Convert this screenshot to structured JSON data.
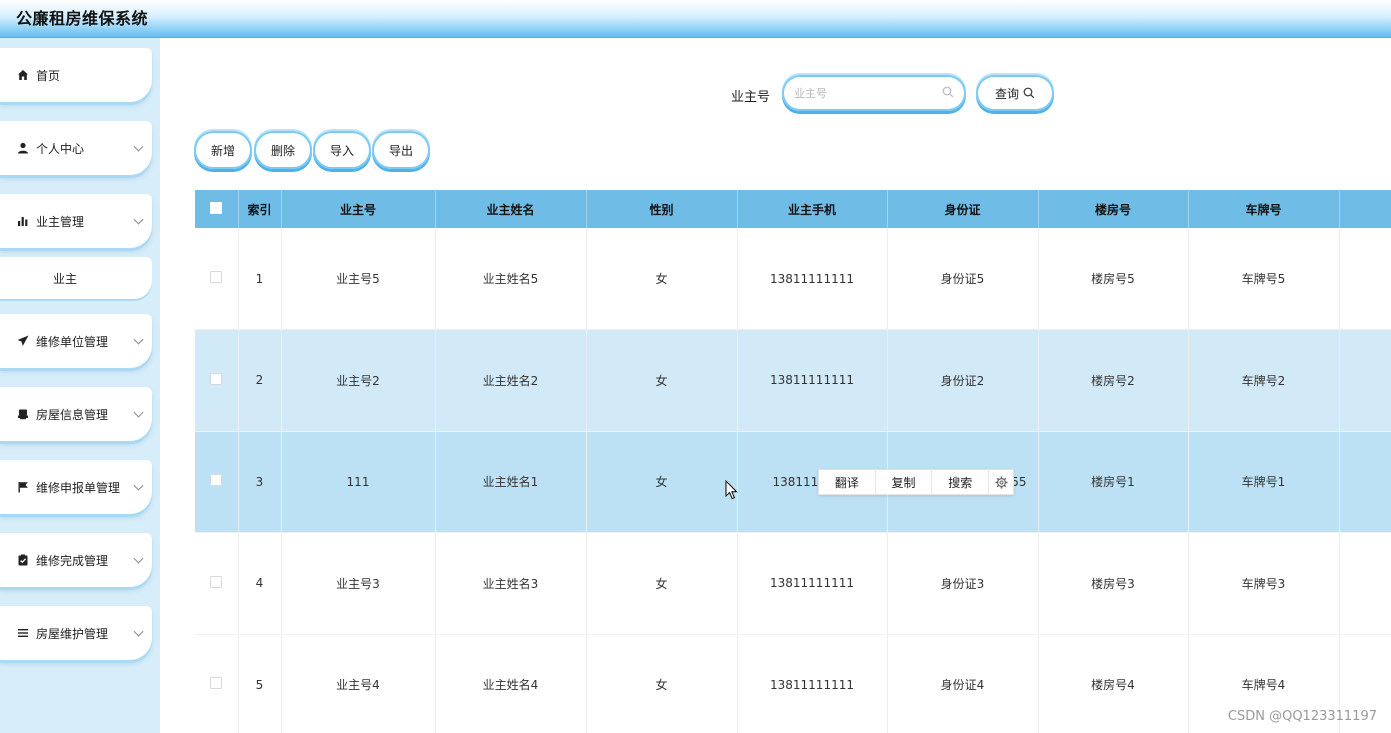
{
  "header": {
    "title": "公廉租房维保系统"
  },
  "sidebar": {
    "items": [
      {
        "label": "首页",
        "icon": "home-icon",
        "has_children": false
      },
      {
        "label": "个人中心",
        "icon": "user-icon",
        "has_children": true
      },
      {
        "label": "业主管理",
        "icon": "bar-chart-icon",
        "has_children": true,
        "expanded": true
      },
      {
        "label": "维修单位管理",
        "icon": "send-icon",
        "has_children": true
      },
      {
        "label": "房屋信息管理",
        "icon": "printer-icon",
        "has_children": true
      },
      {
        "label": "维修申报单管理",
        "icon": "flag-icon",
        "has_children": true
      },
      {
        "label": "维修完成管理",
        "icon": "clipboard-icon",
        "has_children": true
      },
      {
        "label": "房屋维护管理",
        "icon": "list-icon",
        "has_children": true
      }
    ],
    "submenu": {
      "label": "业主"
    }
  },
  "search": {
    "label": "业主号",
    "placeholder": "业主号",
    "value": "",
    "button_label": "查询"
  },
  "actions": {
    "add": "新增",
    "delete": "删除",
    "import": "导入",
    "export": "导出"
  },
  "table": {
    "columns": [
      "索引",
      "业主号",
      "业主姓名",
      "性别",
      "业主手机",
      "身份证",
      "楼房号",
      "车牌号"
    ],
    "rows": [
      {
        "index": "1",
        "owner_no": "业主号5",
        "name": "业主姓名5",
        "gender": "女",
        "phone": "13811111111",
        "id_card": "身份证5",
        "building": "楼房号5",
        "plate": "车牌号5"
      },
      {
        "index": "2",
        "owner_no": "业主号2",
        "name": "业主姓名2",
        "gender": "女",
        "phone": "13811111111",
        "id_card": "身份证2",
        "building": "楼房号2",
        "plate": "车牌号2"
      },
      {
        "index": "3",
        "owner_no": "111",
        "name": "业主姓名1",
        "gender": "女",
        "phone": "138111",
        "id_card": "55",
        "building": "楼房号1",
        "plate": "车牌号1"
      },
      {
        "index": "4",
        "owner_no": "业主号3",
        "name": "业主姓名3",
        "gender": "女",
        "phone": "13811111111",
        "id_card": "身份证3",
        "building": "楼房号3",
        "plate": "车牌号3"
      },
      {
        "index": "5",
        "owner_no": "业主号4",
        "name": "业主姓名4",
        "gender": "女",
        "phone": "13811111111",
        "id_card": "身份证4",
        "building": "楼房号4",
        "plate": "车牌号4"
      }
    ]
  },
  "context_toolbar": {
    "translate": "翻译",
    "copy": "复制",
    "search": "搜索"
  },
  "watermark": "CSDN @QQ123311197"
}
